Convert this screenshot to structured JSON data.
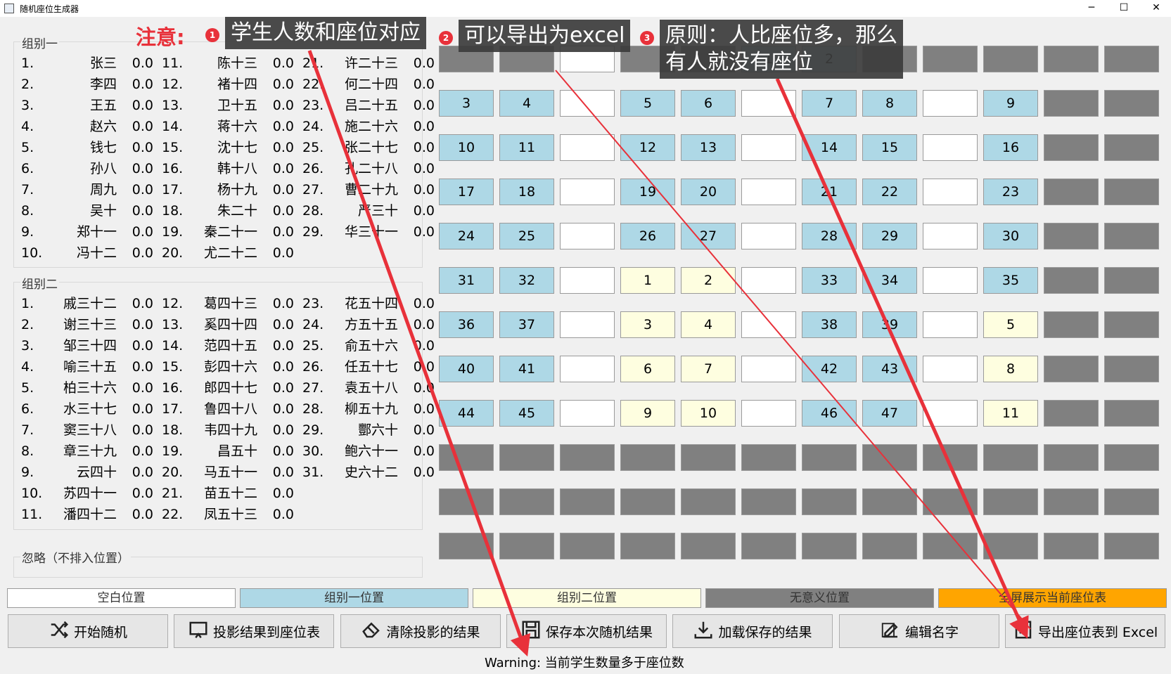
{
  "window": {
    "title": "随机座位生成器",
    "minimize": "─",
    "maximize": "☐",
    "close": "✕"
  },
  "group1": {
    "title": "组别一",
    "students": [
      {
        "num": "1.",
        "name": "张三",
        "score": "0.0"
      },
      {
        "num": "2.",
        "name": "李四",
        "score": "0.0"
      },
      {
        "num": "3.",
        "name": "王五",
        "score": "0.0"
      },
      {
        "num": "4.",
        "name": "赵六",
        "score": "0.0"
      },
      {
        "num": "5.",
        "name": "钱七",
        "score": "0.0"
      },
      {
        "num": "6.",
        "name": "孙八",
        "score": "0.0"
      },
      {
        "num": "7.",
        "name": "周九",
        "score": "0.0"
      },
      {
        "num": "8.",
        "name": "吴十",
        "score": "0.0"
      },
      {
        "num": "9.",
        "name": "郑十一",
        "score": "0.0"
      },
      {
        "num": "10.",
        "name": "冯十二",
        "score": "0.0"
      },
      {
        "num": "11.",
        "name": "陈十三",
        "score": "0.0"
      },
      {
        "num": "12.",
        "name": "褚十四",
        "score": "0.0"
      },
      {
        "num": "13.",
        "name": "卫十五",
        "score": "0.0"
      },
      {
        "num": "14.",
        "name": "蒋十六",
        "score": "0.0"
      },
      {
        "num": "15.",
        "name": "沈十七",
        "score": "0.0"
      },
      {
        "num": "16.",
        "name": "韩十八",
        "score": "0.0"
      },
      {
        "num": "17.",
        "name": "杨十九",
        "score": "0.0"
      },
      {
        "num": "18.",
        "name": "朱二十",
        "score": "0.0"
      },
      {
        "num": "19.",
        "name": "秦二十一",
        "score": "0.0"
      },
      {
        "num": "20.",
        "name": "尤二十二",
        "score": "0.0"
      },
      {
        "num": "21.",
        "name": "许二十三",
        "score": "0.0"
      },
      {
        "num": "22.",
        "name": "何二十四",
        "score": "0.0"
      },
      {
        "num": "23.",
        "name": "吕二十五",
        "score": "0.0"
      },
      {
        "num": "24.",
        "name": "施二十六",
        "score": "0.0"
      },
      {
        "num": "25.",
        "name": "张二十七",
        "score": "0.0"
      },
      {
        "num": "26.",
        "name": "孔二十八",
        "score": "0.0"
      },
      {
        "num": "27.",
        "name": "曹二十九",
        "score": "0.0"
      },
      {
        "num": "28.",
        "name": "严三十",
        "score": "0.0"
      },
      {
        "num": "29.",
        "name": "华三十一",
        "score": "0.0"
      }
    ]
  },
  "group2": {
    "title": "组别二",
    "students": [
      {
        "num": "1.",
        "name": "戚三十二",
        "score": "0.0"
      },
      {
        "num": "2.",
        "name": "谢三十三",
        "score": "0.0"
      },
      {
        "num": "3.",
        "name": "邹三十四",
        "score": "0.0"
      },
      {
        "num": "4.",
        "name": "喻三十五",
        "score": "0.0"
      },
      {
        "num": "5.",
        "name": "柏三十六",
        "score": "0.0"
      },
      {
        "num": "6.",
        "name": "水三十七",
        "score": "0.0"
      },
      {
        "num": "7.",
        "name": "窦三十八",
        "score": "0.0"
      },
      {
        "num": "8.",
        "name": "章三十九",
        "score": "0.0"
      },
      {
        "num": "9.",
        "name": "云四十",
        "score": "0.0"
      },
      {
        "num": "10.",
        "name": "苏四十一",
        "score": "0.0"
      },
      {
        "num": "11.",
        "name": "潘四十二",
        "score": "0.0"
      },
      {
        "num": "12.",
        "name": "葛四十三",
        "score": "0.0"
      },
      {
        "num": "13.",
        "name": "奚四十四",
        "score": "0.0"
      },
      {
        "num": "14.",
        "name": "范四十五",
        "score": "0.0"
      },
      {
        "num": "15.",
        "name": "彭四十六",
        "score": "0.0"
      },
      {
        "num": "16.",
        "name": "郎四十七",
        "score": "0.0"
      },
      {
        "num": "17.",
        "name": "鲁四十八",
        "score": "0.0"
      },
      {
        "num": "18.",
        "name": "韦四十九",
        "score": "0.0"
      },
      {
        "num": "19.",
        "name": "昌五十",
        "score": "0.0"
      },
      {
        "num": "20.",
        "name": "马五十一",
        "score": "0.0"
      },
      {
        "num": "21.",
        "name": "苗五十二",
        "score": "0.0"
      },
      {
        "num": "22.",
        "name": "凤五十三",
        "score": "0.0"
      },
      {
        "num": "23.",
        "name": "花五十四",
        "score": "0.0"
      },
      {
        "num": "24.",
        "name": "方五十五",
        "score": "0.0"
      },
      {
        "num": "25.",
        "name": "俞五十六",
        "score": "0.0"
      },
      {
        "num": "26.",
        "name": "任五十七",
        "score": "0.0"
      },
      {
        "num": "27.",
        "name": "袁五十八",
        "score": "0.0"
      },
      {
        "num": "28.",
        "name": "柳五十九",
        "score": "0.0"
      },
      {
        "num": "29.",
        "name": "酆六十",
        "score": "0.0"
      },
      {
        "num": "30.",
        "name": "鲍六十一",
        "score": "0.0"
      },
      {
        "num": "31.",
        "name": "史六十二",
        "score": "0.0"
      }
    ]
  },
  "ignored": {
    "title": "忽略（不排入位置）"
  },
  "seat_grid": {
    "rows": [
      [
        "N",
        "N",
        "B",
        "N",
        "N",
        "1:1",
        "1:2",
        "N",
        "N",
        "N",
        "N",
        "N"
      ],
      [
        "1:3",
        "1:4",
        "B",
        "1:5",
        "1:6",
        "B",
        "1:7",
        "1:8",
        "B",
        "1:9",
        "N",
        "N"
      ],
      [
        "1:10",
        "1:11",
        "B",
        "1:12",
        "1:13",
        "B",
        "1:14",
        "1:15",
        "B",
        "1:16",
        "N",
        "N"
      ],
      [
        "1:17",
        "1:18",
        "B",
        "1:19",
        "1:20",
        "B",
        "1:21",
        "1:22",
        "B",
        "1:23",
        "N",
        "N"
      ],
      [
        "1:24",
        "1:25",
        "B",
        "1:26",
        "1:27",
        "B",
        "1:28",
        "1:29",
        "B",
        "1:30",
        "N",
        "N"
      ],
      [
        "1:31",
        "1:32",
        "B",
        "2:1",
        "2:2",
        "B",
        "1:33",
        "1:34",
        "B",
        "1:35",
        "N",
        "N"
      ],
      [
        "1:36",
        "1:37",
        "B",
        "2:3",
        "2:4",
        "B",
        "1:38",
        "1:39",
        "B",
        "2:5",
        "N",
        "N"
      ],
      [
        "1:40",
        "1:41",
        "B",
        "2:6",
        "2:7",
        "B",
        "1:42",
        "1:43",
        "B",
        "2:8",
        "N",
        "N"
      ],
      [
        "1:44",
        "1:45",
        "B",
        "2:9",
        "2:10",
        "B",
        "1:46",
        "1:47",
        "B",
        "2:11",
        "N",
        "N"
      ],
      [
        "N",
        "N",
        "N",
        "N",
        "N",
        "N",
        "N",
        "N",
        "N",
        "N",
        "N",
        "N"
      ],
      [
        "N",
        "N",
        "N",
        "N",
        "N",
        "N",
        "N",
        "N",
        "N",
        "N",
        "N",
        "N"
      ],
      [
        "N",
        "N",
        "N",
        "N",
        "N",
        "N",
        "N",
        "N",
        "N",
        "N",
        "N",
        "N"
      ]
    ]
  },
  "colors": {
    "group1": "#aed8e6",
    "group2": "#fefee0",
    "blank": "#ffffff",
    "none": "#808080",
    "fullscreen": "#ffa500",
    "annotation_red": "#e8313a",
    "annotation_bg": "#3c3c3c"
  },
  "legend": {
    "blank": "空白位置",
    "group1": "组别一位置",
    "group2": "组别二位置",
    "none": "无意义位置",
    "fullscreen": "全屏展示当前座位表"
  },
  "buttons": {
    "random": {
      "label": "开始随机",
      "icon": "shuffle-icon"
    },
    "project": {
      "label": "投影结果到座位表",
      "icon": "screen-icon"
    },
    "clear": {
      "label": "清除投影的结果",
      "icon": "eraser-icon"
    },
    "save": {
      "label": "保存本次随机结果",
      "icon": "save-icon"
    },
    "load": {
      "label": "加载保存的结果",
      "icon": "download-icon"
    },
    "edit": {
      "label": "编辑名字",
      "icon": "edit-icon"
    },
    "export": {
      "label": "导出座位表到 Excel",
      "icon": "excel-icon"
    }
  },
  "status": {
    "prefix": "Warning:",
    "message": " 当前学生数量多于座位数"
  },
  "annotations": {
    "heading": "注意:",
    "notes": [
      {
        "num": "1",
        "text": "学生人数和座位对应"
      },
      {
        "num": "2",
        "text": "可以导出为excel"
      },
      {
        "num": "3",
        "line1": "原则：人比座位多，那么",
        "line2": "有人就没有座位"
      }
    ]
  }
}
